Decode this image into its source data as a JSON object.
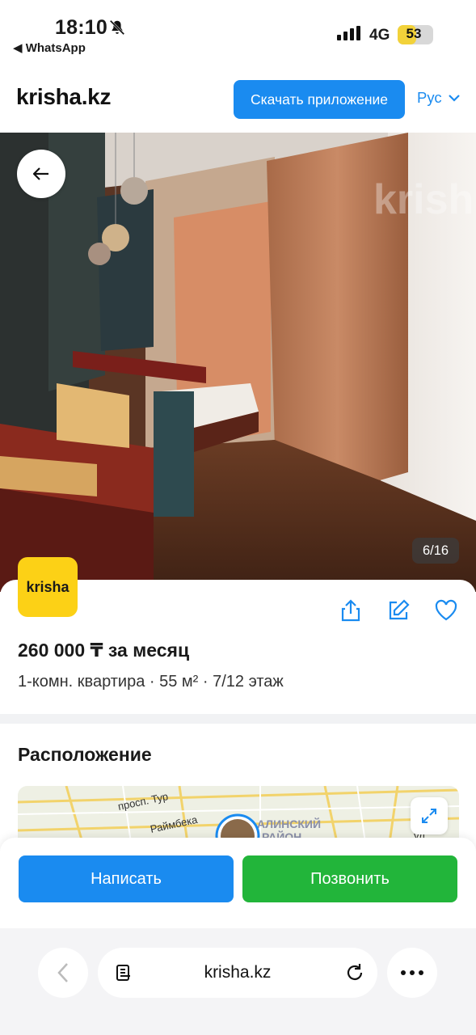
{
  "status_bar": {
    "time": "18:10",
    "back_app": "◀ WhatsApp",
    "network": "4G",
    "battery": "53",
    "battery_level": 0.53
  },
  "header": {
    "logo": "krisha.kz",
    "download_button": "Скачать приложение",
    "language": "Рус"
  },
  "gallery": {
    "counter": "6/16",
    "watermark": "krish"
  },
  "listing": {
    "agency_logo": "krisha",
    "price": "260 000 ₸ за месяц",
    "details": "1-комн. квартира · 55 м² · 7/12 этаж",
    "icons": [
      "share-icon",
      "edit-icon",
      "heart-icon"
    ]
  },
  "location": {
    "title": "Расположение",
    "map_labels": [
      "просп. Тур",
      "Раймбека",
      "АЛИНСКИЙ",
      "РАЙОН",
      "ул."
    ]
  },
  "contact": {
    "write_button": "Написать",
    "call_button": "Позвонить"
  },
  "browser": {
    "url": "krisha.kz"
  },
  "colors": {
    "accent_blue": "#1a8bf0",
    "call_green": "#22b53a",
    "brand_yellow": "#fcd116"
  }
}
